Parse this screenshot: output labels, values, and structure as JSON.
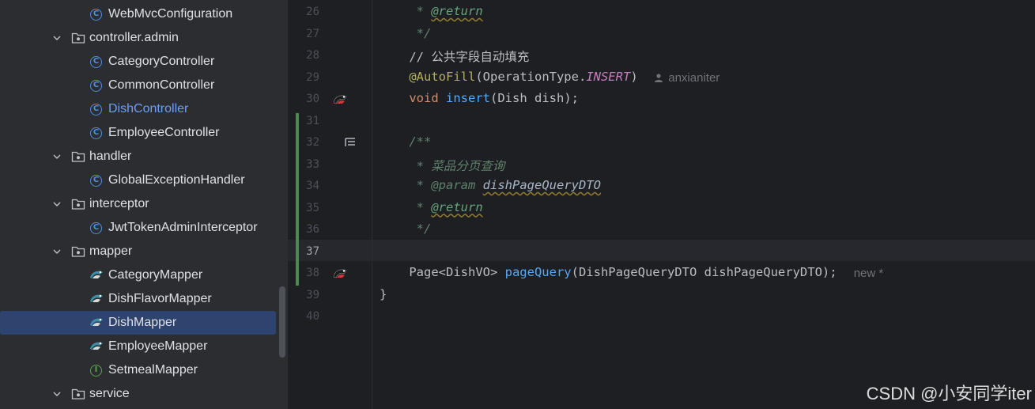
{
  "project_tree": {
    "items": [
      {
        "label": "WebMvcConfiguration",
        "kind": "class",
        "icon": "class-icon",
        "level": 2
      },
      {
        "label": "controller.admin",
        "kind": "package",
        "icon": "folder-icon",
        "level": 1,
        "expanded": true
      },
      {
        "label": "CategoryController",
        "kind": "class",
        "icon": "class-icon",
        "level": 2
      },
      {
        "label": "CommonController",
        "kind": "class",
        "icon": "class-icon",
        "level": 2
      },
      {
        "label": "DishController",
        "kind": "class",
        "icon": "class-icon",
        "level": 2,
        "highlighted": true
      },
      {
        "label": "EmployeeController",
        "kind": "class",
        "icon": "class-icon",
        "level": 2
      },
      {
        "label": "handler",
        "kind": "package",
        "icon": "folder-icon",
        "level": 1,
        "expanded": true
      },
      {
        "label": "GlobalExceptionHandler",
        "kind": "class",
        "icon": "class-icon",
        "level": 2
      },
      {
        "label": "interceptor",
        "kind": "package",
        "icon": "folder-icon",
        "level": 1,
        "expanded": true
      },
      {
        "label": "JwtTokenAdminInterceptor",
        "kind": "class",
        "icon": "class-icon",
        "level": 2
      },
      {
        "label": "mapper",
        "kind": "package",
        "icon": "folder-icon",
        "level": 1,
        "expanded": true
      },
      {
        "label": "CategoryMapper",
        "kind": "mapper",
        "icon": "mybatis-mapper-icon",
        "level": 2
      },
      {
        "label": "DishFlavorMapper",
        "kind": "mapper",
        "icon": "mybatis-mapper-icon",
        "level": 2
      },
      {
        "label": "DishMapper",
        "kind": "mapper",
        "icon": "mybatis-mapper-icon",
        "level": 2,
        "selected": true
      },
      {
        "label": "EmployeeMapper",
        "kind": "mapper",
        "icon": "mybatis-mapper-icon",
        "level": 2
      },
      {
        "label": "SetmealMapper",
        "kind": "interface",
        "icon": "interface-icon",
        "level": 2
      },
      {
        "label": "service",
        "kind": "package",
        "icon": "folder-icon",
        "level": 1,
        "expanded": true
      }
    ]
  },
  "editor": {
    "current_line": "37",
    "lines": [
      {
        "num": "26",
        "tokens": [
          {
            "t": "     * ",
            "c": "cm"
          },
          {
            "t": "@return",
            "c": "tag"
          }
        ]
      },
      {
        "num": "27",
        "tokens": [
          {
            "t": "     */",
            "c": "cm"
          }
        ]
      },
      {
        "num": "28",
        "tokens": [
          {
            "t": "    // ",
            "c": "plain"
          },
          {
            "t": "公共字段自动填充",
            "c": "plain cjk"
          }
        ]
      },
      {
        "num": "29",
        "tokens": [
          {
            "t": "    @AutoFill",
            "c": "ann"
          },
          {
            "t": "(OperationType.",
            "c": "plain"
          },
          {
            "t": "INSERT",
            "c": "cst"
          },
          {
            "t": ")",
            "c": "plain"
          }
        ],
        "hint": "anxianiter"
      },
      {
        "num": "30",
        "tokens": [
          {
            "t": "    void ",
            "c": "kw"
          },
          {
            "t": "insert",
            "c": "fn"
          },
          {
            "t": "(Dish dish);",
            "c": "plain"
          }
        ],
        "gutter_icon": "mybatis-navigate-icon"
      },
      {
        "num": "31",
        "tokens": []
      },
      {
        "num": "32",
        "tokens": [
          {
            "t": "    /**",
            "c": "cm"
          }
        ],
        "gutter_icon": "render-doc-icon"
      },
      {
        "num": "33",
        "tokens": [
          {
            "t": "     * ",
            "c": "cm"
          },
          {
            "t": "菜品分页查询",
            "c": "cm cjk"
          }
        ]
      },
      {
        "num": "34",
        "tokens": [
          {
            "t": "     * ",
            "c": "cm"
          },
          {
            "t": "@param",
            "c": "tag-plain"
          },
          {
            "t": " ",
            "c": "cm"
          },
          {
            "t": "dishPageQueryDTO",
            "c": "pname"
          }
        ]
      },
      {
        "num": "35",
        "tokens": [
          {
            "t": "     * ",
            "c": "cm"
          },
          {
            "t": "@return",
            "c": "tag"
          }
        ]
      },
      {
        "num": "36",
        "tokens": [
          {
            "t": "     */",
            "c": "cm"
          }
        ]
      },
      {
        "num": "37",
        "tokens": []
      },
      {
        "num": "38",
        "tokens": [
          {
            "t": "    Page<DishVO> ",
            "c": "plain"
          },
          {
            "t": "pageQuery",
            "c": "fn"
          },
          {
            "t": "(DishPageQueryDTO dishPageQueryDTO);",
            "c": "plain"
          }
        ],
        "hint": "new *",
        "gutter_icon": "mybatis-navigate-icon"
      },
      {
        "num": "39",
        "tokens": [
          {
            "t": "}",
            "c": "plain"
          }
        ]
      },
      {
        "num": "40",
        "tokens": []
      }
    ]
  },
  "watermark": "CSDN @小安同学iter",
  "colors": {
    "background": "#1e1f22",
    "tree_background": "#2b2d30",
    "selection": "#2e436e",
    "keyword": "#cf8e6d",
    "function": "#56a8f5",
    "comment": "#5f826b",
    "annotation": "#b3ae60",
    "constant": "#c77dbb",
    "change_marker": "#4e8a4f"
  }
}
